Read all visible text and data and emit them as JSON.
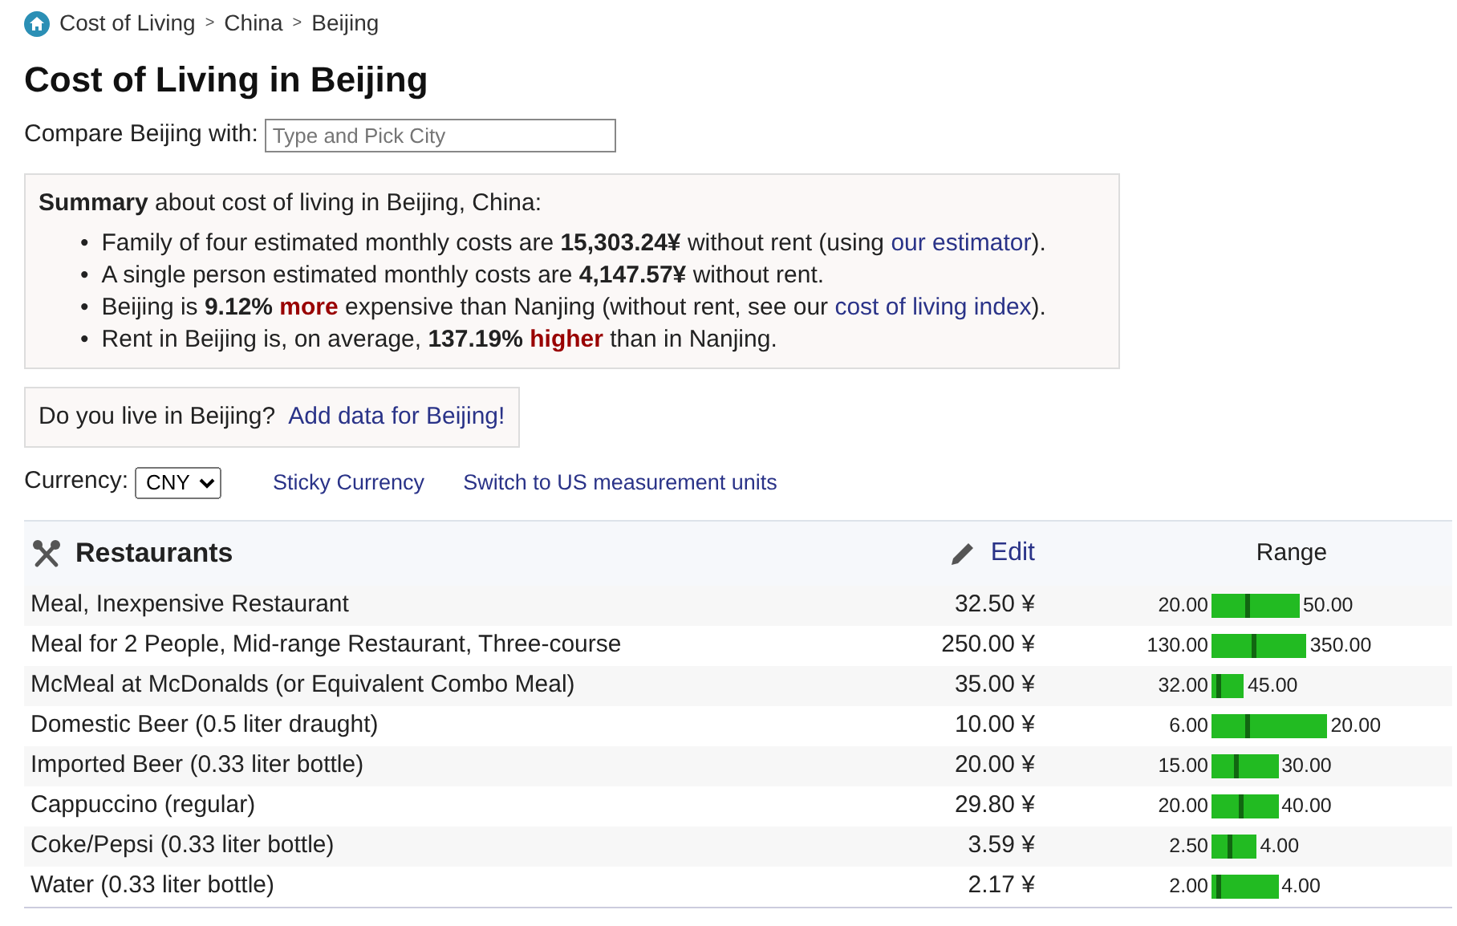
{
  "breadcrumb": {
    "separator": ">",
    "items": [
      "Cost of Living",
      "China",
      "Beijing"
    ]
  },
  "title": "Cost of Living in Beijing",
  "compare": {
    "label": "Compare Beijing with:",
    "placeholder": "Type and Pick City"
  },
  "summary": {
    "bullet": "•",
    "heading": [
      {
        "kind": "strong",
        "text": "Summary"
      },
      {
        "kind": "text",
        "text": " about cost of living in Beijing, China:"
      }
    ],
    "items": [
      [
        {
          "kind": "text",
          "text": "Family of four estimated monthly costs are "
        },
        {
          "kind": "strong",
          "text": "15,303.24¥"
        },
        {
          "kind": "text",
          "text": " without rent (using "
        },
        {
          "kind": "link",
          "text": "our estimator"
        },
        {
          "kind": "text",
          "text": ")."
        }
      ],
      [
        {
          "kind": "text",
          "text": "A single person estimated monthly costs are "
        },
        {
          "kind": "strong",
          "text": "4,147.57¥"
        },
        {
          "kind": "text",
          "text": " without rent."
        }
      ],
      [
        {
          "kind": "text",
          "text": "Beijing is "
        },
        {
          "kind": "strong",
          "text": "9.12% "
        },
        {
          "kind": "alert",
          "text": "more"
        },
        {
          "kind": "text",
          "text": " expensive than Nanjing (without rent, see our "
        },
        {
          "kind": "link",
          "text": "cost of living index"
        },
        {
          "kind": "text",
          "text": ")."
        }
      ],
      [
        {
          "kind": "text",
          "text": "Rent in Beijing is, on average, "
        },
        {
          "kind": "strong",
          "text": "137.19% "
        },
        {
          "kind": "alert",
          "text": "higher"
        },
        {
          "kind": "text",
          "text": " than in Nanjing."
        }
      ]
    ]
  },
  "contribute": {
    "question": "Do you live in Beijing?",
    "link": "Add data for Beijing!"
  },
  "currency": {
    "label": "Currency:",
    "value": "CNY",
    "links": [
      "Sticky Currency",
      "Switch to US measurement units"
    ]
  },
  "section": {
    "title": "Restaurants",
    "edit": "Edit",
    "range_header": "Range",
    "rows": [
      {
        "name": "Meal, Inexpensive Restaurant",
        "price": "32.50 ¥",
        "min": "20.00",
        "max": "50.00",
        "level": 0.4
      },
      {
        "name": "Meal for 2 People, Mid-range Restaurant, Three-course",
        "price": "250.00 ¥",
        "min": "130.00",
        "max": "350.00",
        "level": 0.45
      },
      {
        "name": "McMeal at McDonalds (or Equivalent Combo Meal)",
        "price": "35.00 ¥",
        "min": "32.00",
        "max": "45.00",
        "level": 0.2
      },
      {
        "name": "Domestic Beer (0.5 liter draught)",
        "price": "10.00 ¥",
        "min": "6.00",
        "max": "20.00",
        "level": 0.3
      },
      {
        "name": "Imported Beer (0.33 liter bottle)",
        "price": "20.00 ¥",
        "min": "15.00",
        "max": "30.00",
        "level": 0.35
      },
      {
        "name": "Cappuccino (regular)",
        "price": "29.80 ¥",
        "min": "20.00",
        "max": "40.00",
        "level": 0.45
      },
      {
        "name": "Coke/Pepsi (0.33 liter bottle)",
        "price": "3.59 ¥",
        "min": "2.50",
        "max": "4.00",
        "level": 0.4
      },
      {
        "name": "Water (0.33 liter bottle)",
        "price": "2.17 ¥",
        "min": "2.00",
        "max": "4.00",
        "level": 0.08
      }
    ]
  }
}
